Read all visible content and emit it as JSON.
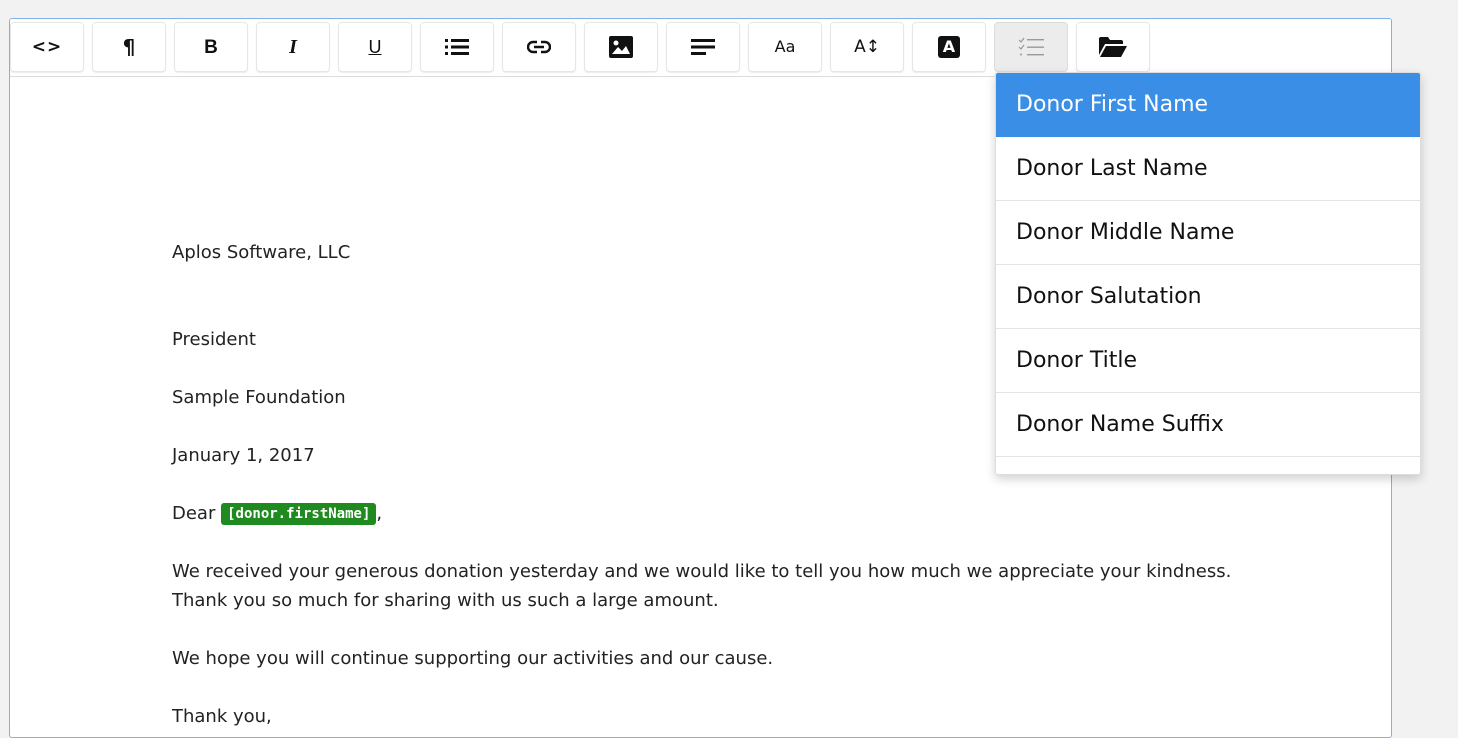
{
  "toolbar": {
    "buttons": [
      {
        "name": "code-view",
        "icon": "code-icon",
        "glyph": "<>"
      },
      {
        "name": "paragraph",
        "icon": "pilcrow-icon",
        "glyph": "¶"
      },
      {
        "name": "bold",
        "icon": "bold-icon",
        "glyph": "B"
      },
      {
        "name": "italic",
        "icon": "italic-icon",
        "glyph": "I"
      },
      {
        "name": "underline",
        "icon": "underline-icon",
        "glyph": "U"
      },
      {
        "name": "list",
        "icon": "list-icon",
        "glyph": ""
      },
      {
        "name": "link",
        "icon": "link-icon",
        "glyph": ""
      },
      {
        "name": "image",
        "icon": "image-icon",
        "glyph": ""
      },
      {
        "name": "align",
        "icon": "align-left-icon",
        "glyph": ""
      },
      {
        "name": "font-family",
        "icon": "font-family-icon",
        "glyph": "Aa"
      },
      {
        "name": "font-size",
        "icon": "font-size-icon",
        "glyph": "A↕"
      },
      {
        "name": "text-color",
        "icon": "text-color-icon",
        "glyph": "A"
      },
      {
        "name": "merge-fields",
        "icon": "checklist-icon",
        "glyph": ""
      },
      {
        "name": "templates",
        "icon": "folder-open-icon",
        "glyph": ""
      }
    ],
    "active_index": 12
  },
  "document": {
    "company": "Aplos Software, LLC",
    "title": "President",
    "organization": "Sample Foundation",
    "date": "January 1, 2017",
    "greeting_prefix": "Dear",
    "merge_tag": "[donor.firstName]",
    "greeting_suffix": ",",
    "body_line1": "We received your generous donation yesterday and we would like to tell you how much we appreciate your kindness.",
    "body_line2": "Thank you so much for sharing with us such a large amount.",
    "body_line3": "We hope you will continue supporting our activities and our cause.",
    "closing": "Thank you,"
  },
  "dropdown": {
    "items": [
      "Donor First Name",
      "Donor Last Name",
      "Donor Middle Name",
      "Donor Salutation",
      "Donor Title",
      "Donor Name Suffix"
    ],
    "selected_index": 0
  },
  "colors": {
    "selected_bg": "#3a8ee6",
    "merge_tag_bg": "#1f8a1f",
    "editor_border": "#7fb2e5"
  }
}
